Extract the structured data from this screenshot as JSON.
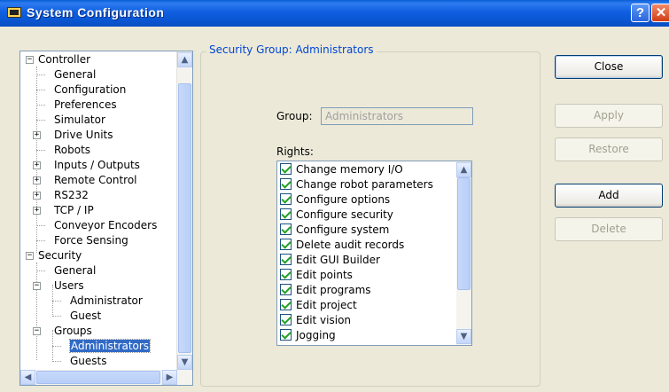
{
  "window": {
    "title": "System Configuration",
    "help_label": "?",
    "close_label": "✕"
  },
  "tree": {
    "items": [
      {
        "label": "Controller",
        "level": 0,
        "expander": "−"
      },
      {
        "label": "General",
        "level": 1
      },
      {
        "label": "Configuration",
        "level": 1
      },
      {
        "label": "Preferences",
        "level": 1
      },
      {
        "label": "Simulator",
        "level": 1
      },
      {
        "label": "Drive Units",
        "level": 1,
        "expander": "+"
      },
      {
        "label": "Robots",
        "level": 1
      },
      {
        "label": "Inputs / Outputs",
        "level": 1,
        "expander": "+"
      },
      {
        "label": "Remote Control",
        "level": 1,
        "expander": "+"
      },
      {
        "label": "RS232",
        "level": 1,
        "expander": "+"
      },
      {
        "label": "TCP / IP",
        "level": 1,
        "expander": "+"
      },
      {
        "label": "Conveyor Encoders",
        "level": 1
      },
      {
        "label": "Force Sensing",
        "level": 1
      },
      {
        "label": "Security",
        "level": 0,
        "expander": "−"
      },
      {
        "label": "General",
        "level": 1
      },
      {
        "label": "Users",
        "level": 1,
        "expander": "−"
      },
      {
        "label": "Administrator",
        "level": 2
      },
      {
        "label": "Guest",
        "level": 2
      },
      {
        "label": "Groups",
        "level": 1,
        "expander": "−"
      },
      {
        "label": "Administrators",
        "level": 2,
        "selected": true
      },
      {
        "label": "Guests",
        "level": 2
      }
    ]
  },
  "security_group": {
    "legend": "Security Group: Administrators",
    "group_label": "Group:",
    "group_value": "Administrators",
    "rights_label": "Rights:",
    "rights": [
      "Change memory I/O",
      "Change robot parameters",
      "Configure options",
      "Configure security",
      "Configure system",
      "Delete audit records",
      "Edit GUI Builder",
      "Edit points",
      "Edit programs",
      "Edit project",
      "Edit vision",
      "Jogging"
    ]
  },
  "buttons": {
    "close": "Close",
    "apply": "Apply",
    "restore": "Restore",
    "add": "Add",
    "delete": "Delete"
  }
}
